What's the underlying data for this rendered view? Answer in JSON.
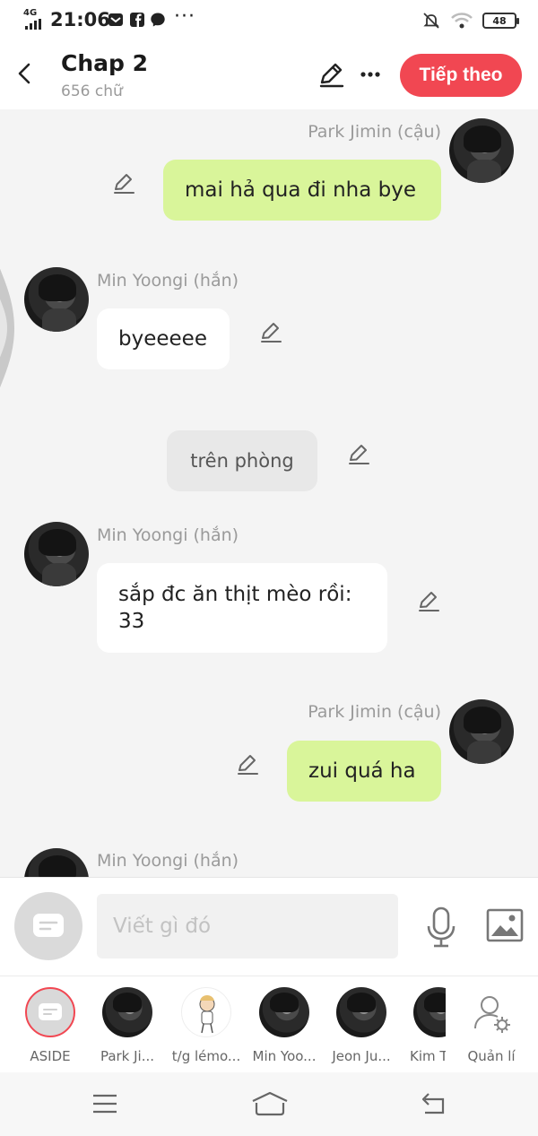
{
  "status_bar": {
    "network": "4G",
    "time": "21:06",
    "battery": "48"
  },
  "header": {
    "title": "Chap 2",
    "word_count": "656 chữ",
    "next_label": "Tiếp theo"
  },
  "messages": [
    {
      "side": "right",
      "speaker": "Park Jimin (cậu)",
      "text": "mai hả qua đi nha bye"
    },
    {
      "side": "left",
      "speaker": "Min Yoongi (hắn)",
      "text": "byeeeee"
    },
    {
      "side": "center",
      "speaker": "",
      "text": "trên phòng"
    },
    {
      "side": "left",
      "speaker": "Min Yoongi (hắn)",
      "text_lines": [
        "sắp đc ăn thịt mèo rồi:",
        "33"
      ]
    },
    {
      "side": "right",
      "speaker": "Park Jimin (cậu)",
      "text": "zui quá ha"
    },
    {
      "side": "left",
      "speaker": "Min Yoongi (hắn)",
      "text": ""
    }
  ],
  "composer": {
    "placeholder": "Viết gì đó"
  },
  "characters": [
    {
      "label": "ASIDE",
      "selected": true
    },
    {
      "label": "Park Ji..."
    },
    {
      "label": "t/g lémo..."
    },
    {
      "label": "Min Yoo..."
    },
    {
      "label": "Jeon Ju..."
    },
    {
      "label": "Kim T"
    },
    {
      "label": "Quản lí"
    }
  ],
  "colors": {
    "accent": "#f14752",
    "my_bubble": "#d9f59a",
    "other_bubble": "#ffffff",
    "narration_bubble": "#e8e8e8",
    "background": "#f4f4f4"
  },
  "icons": [
    "back-arrow-icon",
    "pen-icon",
    "more-icon",
    "chat-icon",
    "mic-icon",
    "image-icon",
    "manage-icon",
    "menu-icon",
    "home-icon",
    "return-icon"
  ]
}
